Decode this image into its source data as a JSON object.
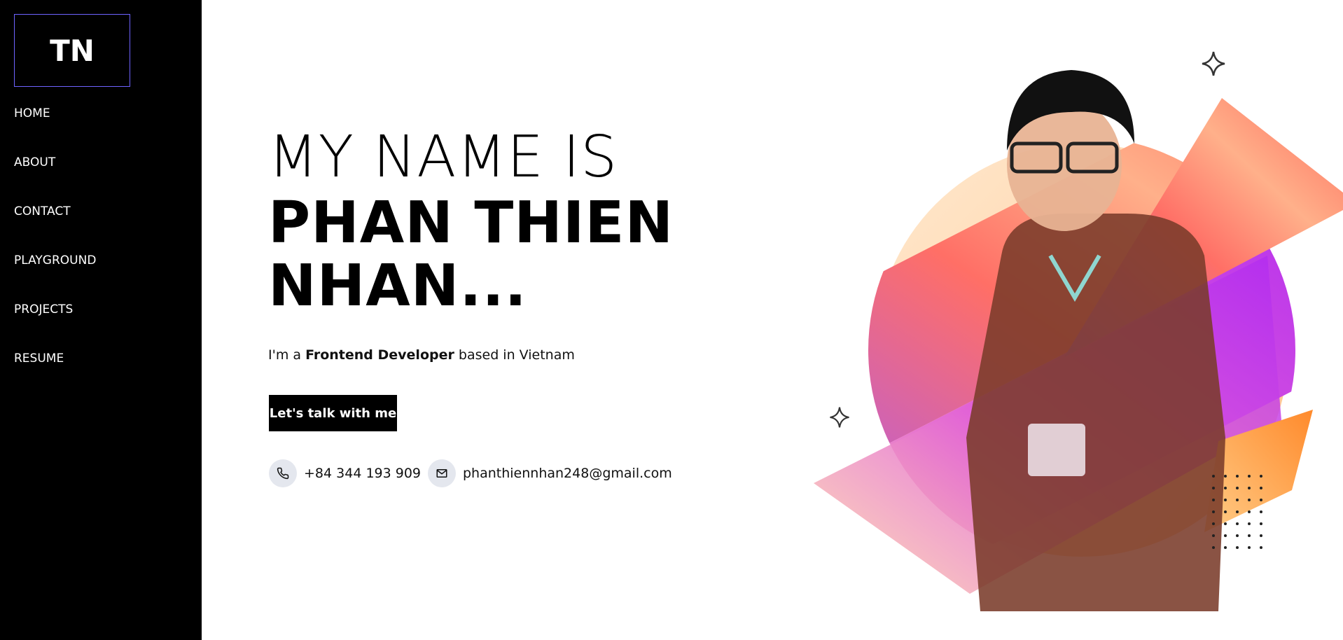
{
  "sidebar": {
    "logo": "TN",
    "items": [
      {
        "label": "HOME"
      },
      {
        "label": "ABOUT"
      },
      {
        "label": "CONTACT"
      },
      {
        "label": "PLAYGROUND"
      },
      {
        "label": "PROJECTS"
      },
      {
        "label": "RESUME"
      }
    ]
  },
  "hero": {
    "intro": "MY NAME IS",
    "name": "PHAN THIEN NHAN...",
    "tagline_prefix": "I'm a",
    "tagline_role": "Frontend Developer",
    "tagline_suffix": "based in Vietnam",
    "cta_label": "Let's talk with me"
  },
  "contact": {
    "phone": "+84 344 193 909",
    "email": "phanthiennhan248@gmail.com",
    "phone_icon": "phone-icon",
    "email_icon": "mail-icon"
  },
  "colors": {
    "sidebar_bg": "#000000",
    "logo_border": "#6e63ff",
    "accent_orange": "#ff6a5c",
    "accent_purple": "#b233f0",
    "accent_peach": "#ffd7a8"
  }
}
